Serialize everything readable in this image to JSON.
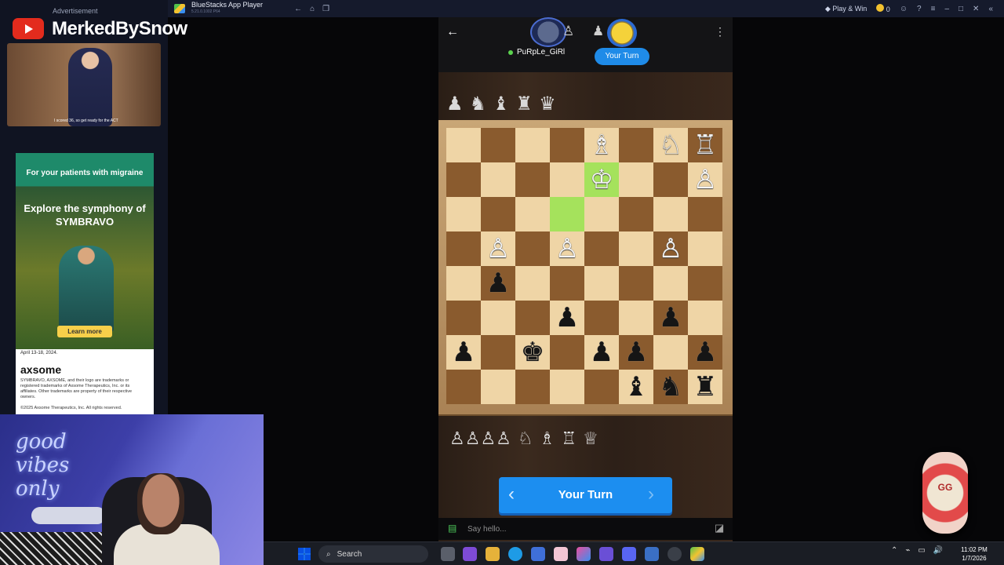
{
  "bluestacks": {
    "title": "BlueStacks App Player",
    "version": "5.21.0.1002  P64",
    "play_win_label": "Play & Win",
    "coins": "0"
  },
  "stream": {
    "advertisement_label": "Advertisement",
    "channel_name": "MerkedBySnow",
    "video_caption": "I scored 36, so get ready for the ACT"
  },
  "ad": {
    "headline": "For your patients with migraine",
    "tagline": "Explore the symphony of SYMBRAVO",
    "button": "Learn more",
    "date": "April 13-18, 2024.",
    "brand": "axsome",
    "fine_print": "SYMBRAVO, AXSOME, and their logo are trademarks or registered trademarks of Axsome Therapeutics, Inc. or its affiliates. Other trademarks are property of their respective owners.",
    "copyright": "©2025 Axsome Therapeutics, Inc. All rights reserved."
  },
  "webcam": {
    "neon_sign": "good vibes only"
  },
  "game": {
    "opponent_name": "PuRpLe_GiRl",
    "turn_badge": "Your Turn",
    "turn_button": "Your Turn",
    "captured_top": [
      "♟",
      "♞",
      "♝",
      "♜",
      "♛"
    ],
    "captured_bottom": [
      "♙♙♙♙",
      "♘",
      "♗",
      "♖",
      "♕"
    ],
    "board": [
      [
        "",
        "",
        "",
        "",
        "♗",
        "",
        "♘",
        "♖"
      ],
      [
        "",
        "",
        "",
        "",
        "♔",
        "",
        "",
        "♙"
      ],
      [
        "",
        "",
        "",
        "",
        "",
        "",
        "",
        ""
      ],
      [
        "",
        "♙",
        "",
        "♙",
        "",
        "",
        "♙",
        ""
      ],
      [
        "",
        "♟",
        "",
        "",
        "",
        "",
        "",
        ""
      ],
      [
        "",
        "",
        "",
        "♟",
        "",
        "",
        "♟",
        ""
      ],
      [
        "♟",
        "",
        "♚",
        "",
        "♟",
        "♟",
        "",
        "♟"
      ],
      [
        "",
        "",
        "",
        "",
        "",
        "♝",
        "♞",
        "♜"
      ]
    ],
    "highlighted_squares": [
      "1-4",
      "2-3"
    ],
    "chat_placeholder": "Say hello..."
  },
  "taskbar": {
    "search_label": "Search",
    "time": "11:02 PM",
    "date": "1/7/2026"
  },
  "badge": {
    "text": "GG"
  },
  "colors": {
    "accent": "#1c8ef0",
    "board_light": "#efd5a6",
    "board_dark": "#8a5b2e",
    "highlight": "#a5e25c"
  }
}
